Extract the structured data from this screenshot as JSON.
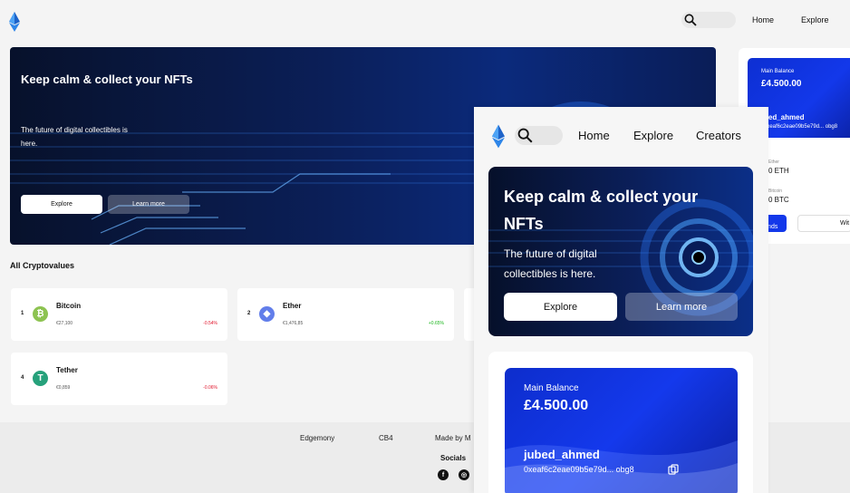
{
  "header": {
    "nav": [
      "Home",
      "Explore"
    ]
  },
  "hero": {
    "title": "Keep calm & collect your NFTs",
    "subtitle": "The future of digital collectibles is here.",
    "explore_label": "Explore",
    "learn_label": "Learn more"
  },
  "crypto": {
    "section_title": "All Cryptovalues",
    "coins": [
      {
        "rank": "1",
        "name": "Bitcoin",
        "price": "€27,100",
        "change": "-0.54%",
        "color": "#8dc351",
        "symbol": "₿"
      },
      {
        "rank": "2",
        "name": "Ether",
        "price": "€1,476,85",
        "change": "+0.65%",
        "color": "#627eea",
        "symbol": "◆"
      },
      {
        "rank": "4",
        "name": "Tether",
        "price": "€0,859",
        "change": "-0.06%",
        "color": "#26a17b",
        "symbol": "T"
      }
    ]
  },
  "footer": {
    "links": [
      "Edgemony",
      "CB4",
      "Made by M"
    ],
    "socials_title": "Socials",
    "social_icons": [
      "facebook-icon",
      "instagram-icon"
    ]
  },
  "wallet": {
    "balance_label": "Main Balance",
    "balance": "£4.500.00",
    "username_partial": "bed_ahmed",
    "username": "jubed_ahmed",
    "address": "0xeaf6c2eae09b5e79d... obg8",
    "eth_label": "Ether",
    "eth_value_partial": "0 ETH",
    "btc_label": "Bitcoin",
    "btc_value_partial": "0 BTC",
    "add_funds_partial": "dd Founds",
    "withdraw_partial": "Wit"
  },
  "mobile": {
    "nav": [
      "Home",
      "Explore",
      "Creators"
    ],
    "hero_title": "Keep calm & collect your NFTs",
    "hero_subtitle": "The future of digital collectibles is here.",
    "explore_label": "Explore",
    "learn_label": "Learn more",
    "balance_label": "Main Balance",
    "balance": "£4.500.00",
    "username": "jubed_ahmed",
    "address": "0xeaf6c2eae09b5e79d... obg8"
  },
  "colors": {
    "accent": "#1338ea",
    "hero_dark": "#07112b",
    "negative": "#e0142a",
    "positive": "#19b51a"
  }
}
